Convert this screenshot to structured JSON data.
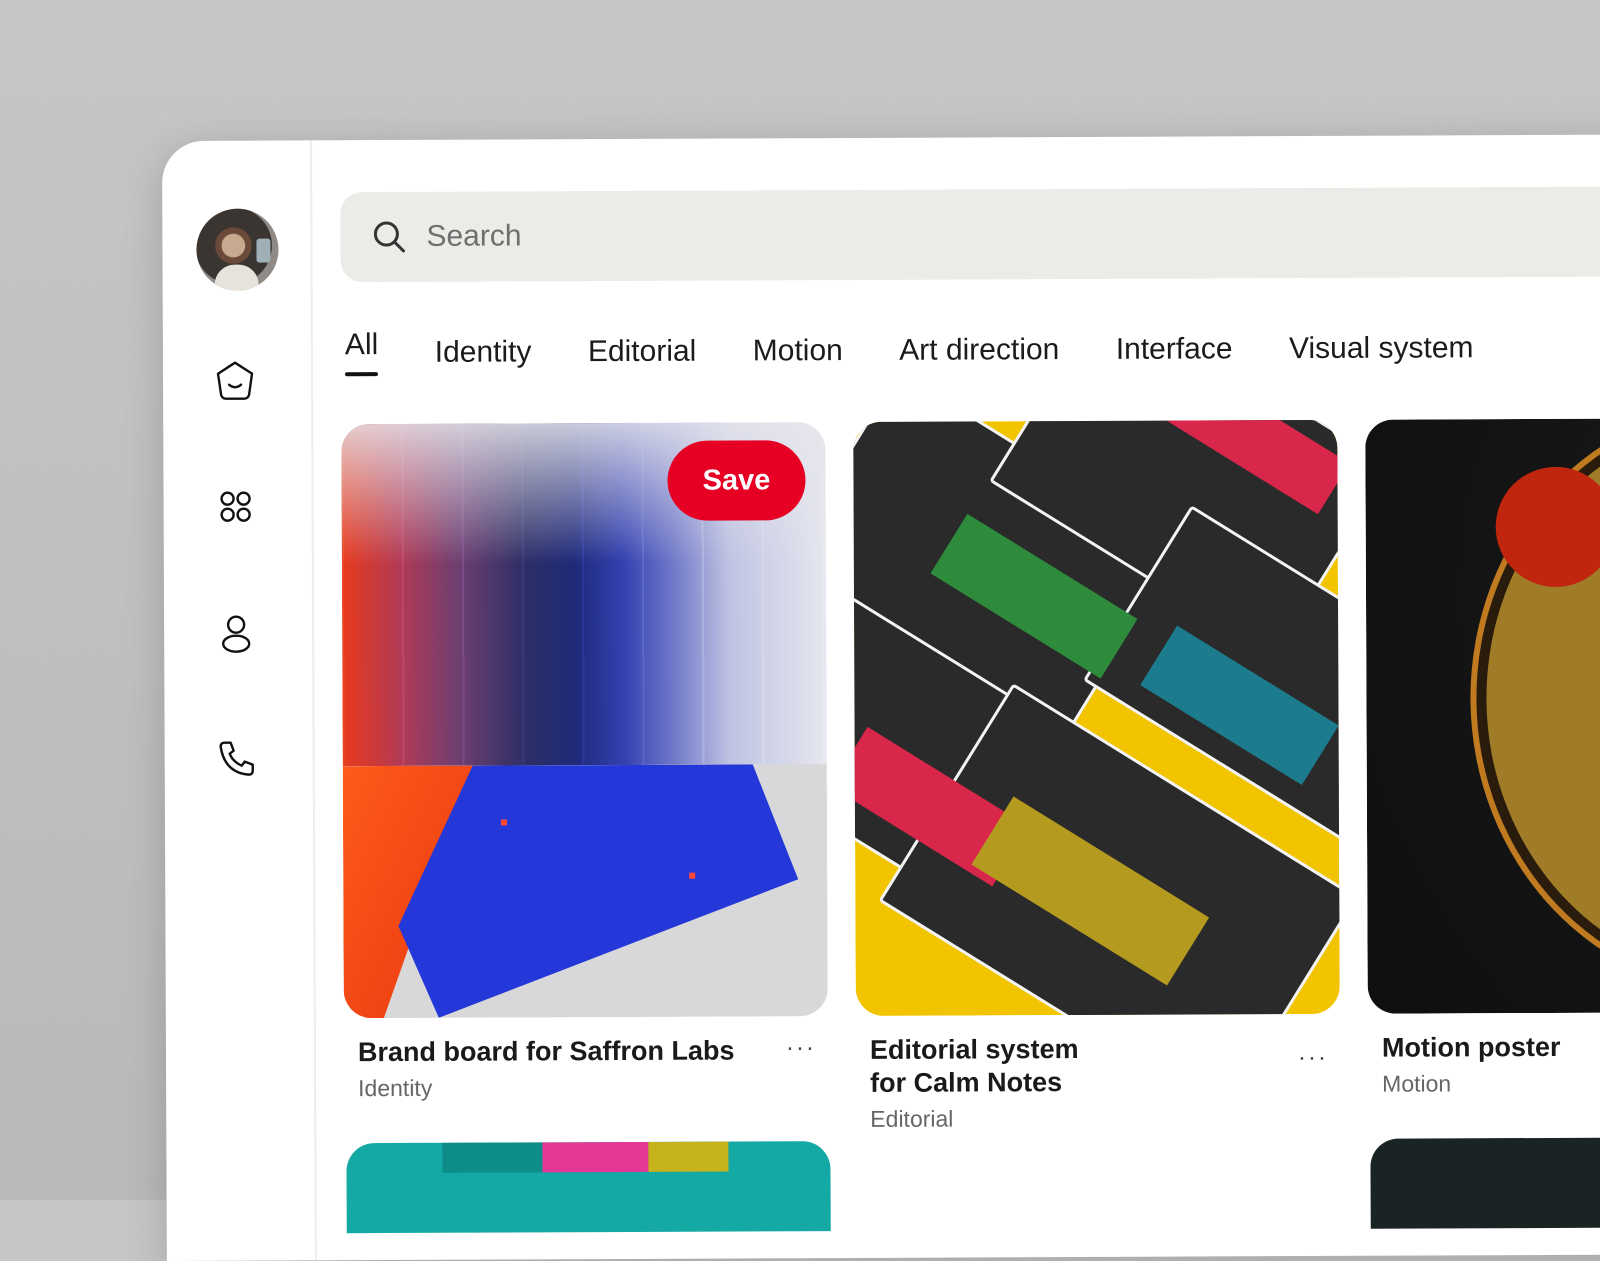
{
  "search": {
    "placeholder": "Search"
  },
  "tabs": [
    {
      "label": "All",
      "active": true
    },
    {
      "label": "Identity"
    },
    {
      "label": "Editorial"
    },
    {
      "label": "Motion"
    },
    {
      "label": "Art direction"
    },
    {
      "label": "Interface"
    },
    {
      "label": "Visual system"
    }
  ],
  "cards": [
    {
      "title": "Brand board for Saffron Labs",
      "category": "Identity",
      "more": "···",
      "save_label": "Save"
    },
    {
      "title": "Editorial system for Calm Notes",
      "category": "Editorial",
      "more": "···"
    },
    {
      "title": "Motion poster",
      "category": "Motion"
    }
  ],
  "colors": {
    "save": "#e60023",
    "search_bg": "#ebebe8",
    "accent_dark": "#111111"
  },
  "icons": [
    "home-icon",
    "grid-icon",
    "profile-icon",
    "phone-icon",
    "search-icon"
  ]
}
